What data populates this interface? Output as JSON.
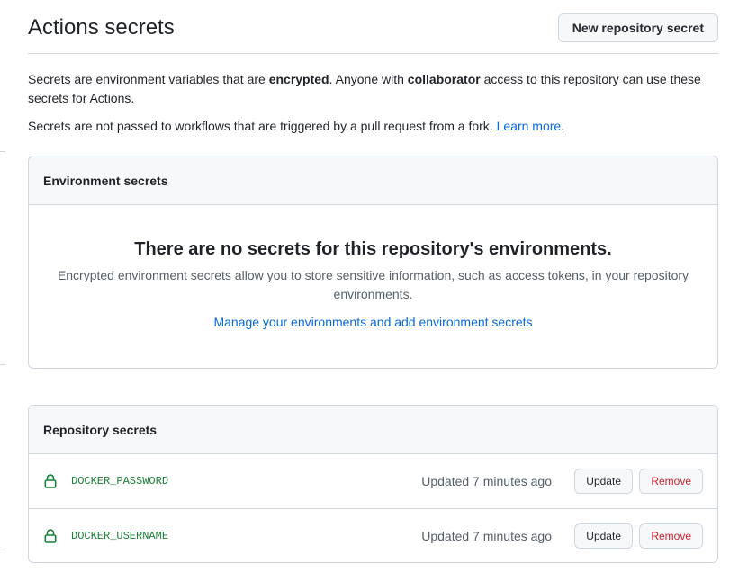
{
  "header": {
    "title": "Actions secrets",
    "new_secret_label": "New repository secret"
  },
  "intro": {
    "p1_a": "Secrets are environment variables that are ",
    "p1_b": "encrypted",
    "p1_c": ". Anyone with ",
    "p1_d": "collaborator",
    "p1_e": " access to this repository can use these secrets for Actions.",
    "p2_a": "Secrets are not passed to workflows that are triggered by a pull request from a fork. ",
    "p2_link": "Learn more",
    "p2_end": "."
  },
  "environment": {
    "header": "Environment secrets",
    "empty_title": "There are no secrets for this repository's environments.",
    "empty_desc": "Encrypted environment secrets allow you to store sensitive information, such as access tokens, in your repository environments.",
    "manage_link": "Manage your environments and add environment secrets"
  },
  "repository": {
    "header": "Repository secrets",
    "secrets": [
      {
        "icon": "lock-icon",
        "name": "DOCKER_PASSWORD",
        "updated": "Updated 7 minutes ago",
        "update_label": "Update",
        "remove_label": "Remove"
      },
      {
        "icon": "lock-icon",
        "name": "DOCKER_USERNAME",
        "updated": "Updated 7 minutes ago",
        "update_label": "Update",
        "remove_label": "Remove"
      }
    ]
  },
  "colors": {
    "link": "#0969da",
    "secret_name": "#1a7f37",
    "lock_icon": "#1a7f37",
    "remove": "#cf222e",
    "border": "#d0d7de",
    "header_bg": "#f6f8fa"
  }
}
